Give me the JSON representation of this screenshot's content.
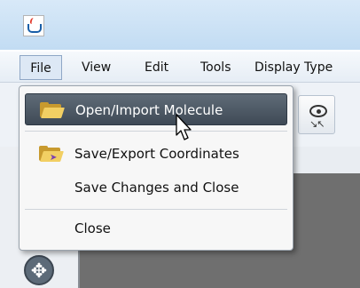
{
  "menubar": {
    "items": [
      "File",
      "View",
      "Edit",
      "Tools",
      "Display Type"
    ]
  },
  "file_menu": {
    "items": [
      {
        "label": "Open/Import Molecule",
        "icon": "open-folder-icon",
        "highlighted": true
      },
      {
        "label": "Save/Export Coordinates",
        "icon": "save-folder-icon"
      },
      {
        "label": "Save Changes and Close"
      },
      {
        "label": "Close"
      }
    ]
  },
  "toolbar": {
    "eye_button_icon": "eye-zoom-icon",
    "eye_button_caption": "↘↖"
  },
  "left_panel": {
    "move_icon_glyph": "✥"
  },
  "colors": {
    "menu_highlight": "#4b5663",
    "canvas": "#6f6f6f",
    "folder": "#f2cf63"
  }
}
